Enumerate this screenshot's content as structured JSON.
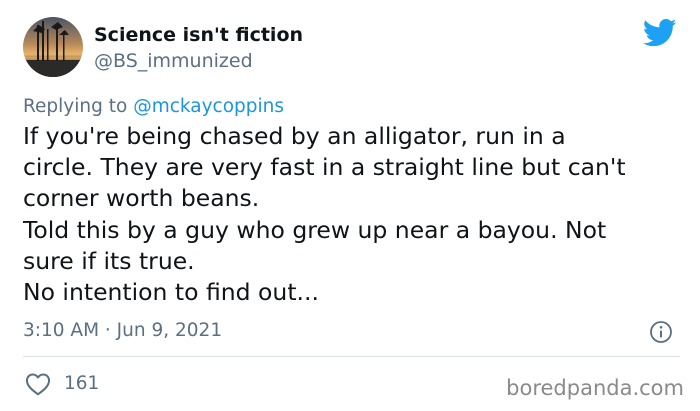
{
  "author": {
    "display_name": "Science isn't fiction",
    "handle": "@BS_immunized",
    "avatar_icon": "sunset-trees-avatar"
  },
  "reply": {
    "prefix": "Replying to ",
    "mention": "@mckaycoppins"
  },
  "tweet_lines": [
    "If you're being chased by an alligator, run in a",
    "circle. They are very fast in a straight line but can't",
    "corner worth beans.",
    "Told this by a guy who grew up near a bayou. Not",
    "sure if its true.",
    "No intention to find out..."
  ],
  "timestamp": "3:10 AM · Jun 9, 2021",
  "likes": "161",
  "watermark": "boredpanda.com",
  "icons": {
    "brand": "twitter-bird-icon",
    "info": "info-icon",
    "like": "heart-icon"
  },
  "colors": {
    "twitter_blue": "#1da1f2",
    "mention_blue": "#1b95e0",
    "secondary_text": "#5b7083",
    "divider": "#d9e1e7"
  }
}
